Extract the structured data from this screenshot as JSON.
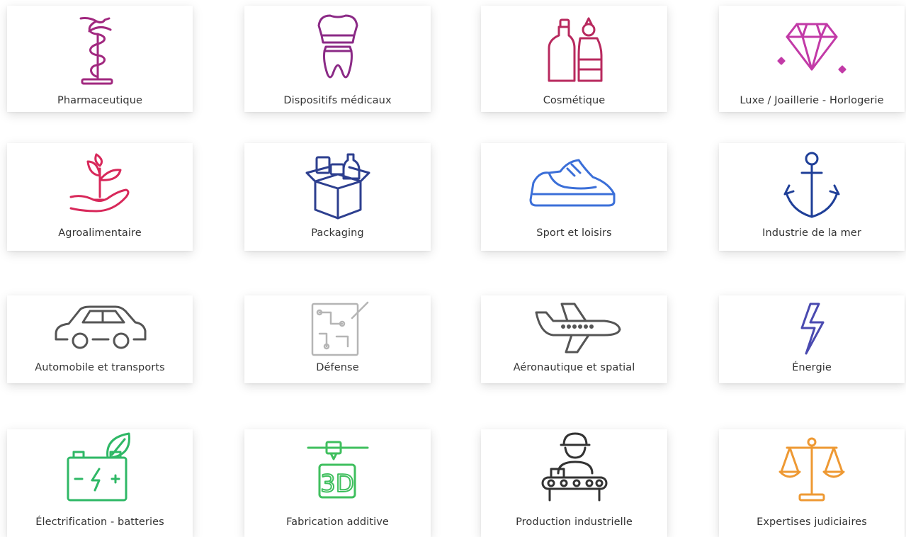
{
  "sectors": [
    {
      "label": "Pharmaceutique",
      "icon": "caduceus-icon",
      "color": "#a1287f"
    },
    {
      "label": "Dispositifs médicaux",
      "icon": "dental-crown-icon",
      "color": "#8b2a86"
    },
    {
      "label": "Cosmétique",
      "icon": "cosmetic-bottles-icon",
      "color": "#b8295e"
    },
    {
      "label": "Luxe / Joaillerie - Horlogerie",
      "icon": "diamond-icon",
      "color": "#c23aa7"
    },
    {
      "label": "Agroalimentaire",
      "icon": "plant-hand-icon",
      "color": "#d8285a"
    },
    {
      "label": "Packaging",
      "icon": "open-box-icon",
      "color": "#2d3f8f"
    },
    {
      "label": "Sport et loisirs",
      "icon": "sneaker-icon",
      "color": "#3b6fd8"
    },
    {
      "label": "Industrie de la mer",
      "icon": "anchor-icon",
      "color": "#1f3f98"
    },
    {
      "label": "Automobile et transports",
      "icon": "car-icon",
      "color": "#555555"
    },
    {
      "label": "Défense",
      "icon": "circuit-board-icon",
      "color": "#b5b5b5"
    },
    {
      "label": "Aéronautique et spatial",
      "icon": "airplane-icon",
      "color": "#555555"
    },
    {
      "label": "Énergie",
      "icon": "lightning-icon",
      "color": "#4a4ab0"
    },
    {
      "label": "Électrification - batteries",
      "icon": "battery-leaf-icon",
      "color": "#2fb866"
    },
    {
      "label": "Fabrication additive",
      "icon": "3d-printer-icon",
      "color": "#3fbf5e"
    },
    {
      "label": "Production industrielle",
      "icon": "factory-worker-icon",
      "color": "#333333"
    },
    {
      "label": "Expertises judiciaires",
      "icon": "scales-icon",
      "color": "#ee9933"
    }
  ]
}
